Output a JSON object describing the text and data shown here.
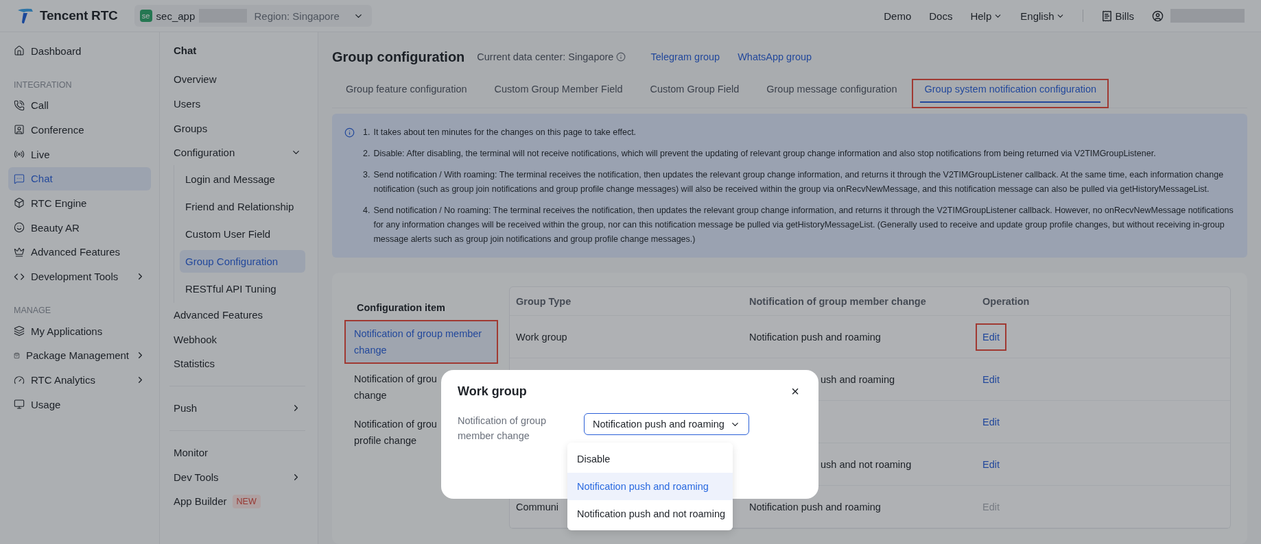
{
  "topbar": {
    "brand": "Tencent RTC",
    "app": {
      "badge": "se",
      "name": "sec_app",
      "region": "Region: Singapore"
    },
    "links": [
      {
        "label": "Demo",
        "has_menu": false
      },
      {
        "label": "Docs",
        "has_menu": false
      },
      {
        "label": "Help",
        "has_menu": true
      },
      {
        "label": "English",
        "has_menu": true
      }
    ],
    "bills": "Bills"
  },
  "nav": [
    {
      "kind": "item",
      "label": "Dashboard",
      "selected": false,
      "has_submenu": false
    },
    {
      "kind": "heading",
      "label": "INTEGRATION"
    },
    {
      "kind": "item",
      "label": "Call",
      "selected": false,
      "has_submenu": false
    },
    {
      "kind": "item",
      "label": "Conference",
      "selected": false,
      "has_submenu": false
    },
    {
      "kind": "item",
      "label": "Live",
      "selected": false,
      "has_submenu": false
    },
    {
      "kind": "item",
      "label": "Chat",
      "selected": true,
      "has_submenu": false
    },
    {
      "kind": "item",
      "label": "RTC Engine",
      "selected": false,
      "has_submenu": false
    },
    {
      "kind": "item",
      "label": "Beauty AR",
      "selected": false,
      "has_submenu": false
    },
    {
      "kind": "item",
      "label": "Advanced Features",
      "selected": false,
      "has_submenu": false
    },
    {
      "kind": "item",
      "label": "Development Tools",
      "selected": false,
      "has_submenu": true
    },
    {
      "kind": "heading",
      "label": "MANAGE"
    },
    {
      "kind": "item",
      "label": "My Applications",
      "selected": false,
      "has_submenu": false
    },
    {
      "kind": "item",
      "label": "Package Management",
      "selected": false,
      "has_submenu": true
    },
    {
      "kind": "item",
      "label": "RTC Analytics",
      "selected": false,
      "has_submenu": true
    },
    {
      "kind": "item",
      "label": "Usage",
      "selected": false,
      "has_submenu": false
    }
  ],
  "subnav": {
    "title": "Chat",
    "groups": [
      [
        {
          "label": "Overview",
          "has_submenu": false
        },
        {
          "label": "Users",
          "has_submenu": false
        },
        {
          "label": "Groups",
          "has_submenu": false
        },
        {
          "label": "Configuration",
          "has_submenu": true,
          "expanded": true,
          "children": [
            {
              "label": "Login and Message",
              "selected": false
            },
            {
              "label": "Friend and Relationship",
              "selected": false
            },
            {
              "label": "Custom User Field",
              "selected": false
            },
            {
              "label": "Group Configuration",
              "selected": true
            },
            {
              "label": "RESTful API Tuning",
              "selected": false
            }
          ]
        },
        {
          "label": "Advanced Features",
          "has_submenu": false
        },
        {
          "label": "Webhook",
          "has_submenu": false
        },
        {
          "label": "Statistics",
          "has_submenu": false
        }
      ],
      [
        {
          "label": "Push",
          "has_submenu": true
        }
      ],
      [
        {
          "label": "Monitor",
          "has_submenu": false
        },
        {
          "label": "Dev Tools",
          "has_submenu": true
        },
        {
          "label": "App Builder",
          "has_submenu": false,
          "badge": "NEW"
        }
      ]
    ]
  },
  "page": {
    "title": "Group configuration",
    "data_center": "Current data center: Singapore",
    "links": [
      "Telegram group",
      "WhatsApp group"
    ],
    "tabs": [
      {
        "label": "Group feature configuration",
        "selected": false,
        "annotated": false
      },
      {
        "label": "Custom Group Member Field",
        "selected": false,
        "annotated": false
      },
      {
        "label": "Custom Group Field",
        "selected": false,
        "annotated": false
      },
      {
        "label": "Group message configuration",
        "selected": false,
        "annotated": false
      },
      {
        "label": "Group system notification configuration",
        "selected": true,
        "annotated": true
      }
    ],
    "notes": [
      {
        "number": "1.",
        "text": "It takes about ten minutes for the changes on this page to take effect."
      },
      {
        "number": "2.",
        "text": "Disable: After disabling, the terminal will not receive notifications, which will prevent the updating of relevant group change information and also stop notifications from being returned via V2TIMGroupListener."
      },
      {
        "number": "3.",
        "text": "Send notification / With roaming: The terminal receives the notification, then updates the relevant group change information, and returns it through the V2TIMGroupListener callback. At the same time, each information change notification (such as group join notifications and group profile change messages) will also be received within the group via onRecvNewMessage, and this notification message can also be pulled via getHistoryMessageList."
      },
      {
        "number": "4.",
        "text": "Send notification / No roaming: The terminal receives the notification, then updates the relevant group change information, and returns it through the V2TIMGroupListener callback. However, no onRecvNewMessage notifications for any information changes will be received within the group, nor can this notification message be pulled via getHistoryMessageList. (Generally used to receive and update group profile changes, but without receiving in-group message alerts such as group join notifications and group profile change messages.)"
      }
    ],
    "config_heading": "Configuration item",
    "config_items": [
      {
        "lines": [
          "Notification of group member",
          "change"
        ],
        "selected": true,
        "annotated": true
      },
      {
        "lines": [
          "Notification of grou",
          "change"
        ],
        "selected": false,
        "annotated": false
      },
      {
        "lines": [
          "Notification of grou",
          "profile change"
        ],
        "selected": false,
        "annotated": false
      }
    ],
    "columns": [
      "Group Type",
      "Notification of group member change",
      "Operation"
    ],
    "rows": [
      {
        "group_type": "Work group",
        "notification": "Notification push and roaming",
        "operation": "Edit",
        "disabled": false,
        "annotated": true
      },
      {
        "notification": "ush and roaming",
        "clipped": true,
        "operation": "Edit",
        "disabled": false,
        "annotated": false
      },
      {
        "operation": "Edit",
        "disabled": false,
        "annotated": false
      },
      {
        "notification": "ush and not roaming",
        "clipped": true,
        "operation": "Edit",
        "disabled": false,
        "annotated": false
      },
      {
        "group_type": "Communi",
        "notification": "Notification push and roaming",
        "operation": "Edit",
        "disabled": true,
        "annotated": false
      }
    ]
  },
  "modal": {
    "title": "Work group",
    "close": "×",
    "field_label": "Notification of group member change",
    "value": "Notification push and roaming",
    "options": [
      {
        "label": "Disable",
        "selected": false
      },
      {
        "label": "Notification push and roaming",
        "selected": true
      },
      {
        "label": "Notification push and not roaming",
        "selected": false
      }
    ]
  }
}
